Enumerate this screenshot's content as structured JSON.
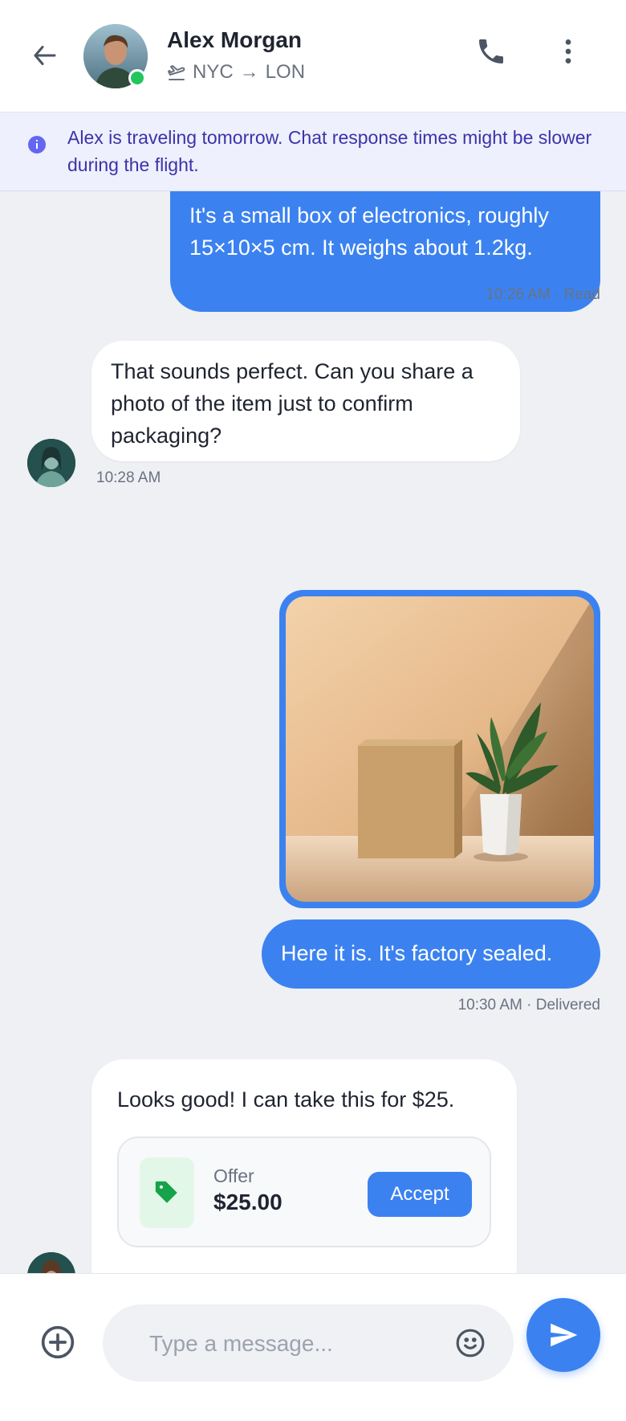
{
  "header": {
    "contact_name": "Alex Morgan",
    "trip_from": "NYC",
    "trip_arrow": "→",
    "trip_to": "LON",
    "online": true
  },
  "notice": {
    "text": "Alex is traveling tomorrow. Chat response times might be slower during the flight."
  },
  "messages": [
    {
      "direction": "outgoing",
      "text": "It's a small box of electronics, roughly 15×10×5 cm. It weighs about 1.2kg.",
      "time": "10:26 AM",
      "status": "Read"
    },
    {
      "direction": "incoming",
      "text": "That sounds perfect. Can you share a photo of the item just to confirm packaging?",
      "time": "10:28 AM"
    },
    {
      "direction": "outgoing",
      "type": "image",
      "image_desc": "cardboard box and potted plant"
    },
    {
      "direction": "outgoing",
      "text": "Here it is. It's factory sealed.",
      "time": "10:30 AM",
      "status": "Delivered"
    },
    {
      "direction": "incoming",
      "text": "Looks good! I can take this for $25.",
      "offer": {
        "label": "Offer",
        "amount": "$25.00",
        "accept_label": "Accept"
      }
    }
  ],
  "meta_separator": " · ",
  "composer": {
    "placeholder": "Type a message..."
  },
  "icons": {
    "back": "arrow-left-icon",
    "call": "phone-icon",
    "more": "more-vertical-icon",
    "plane": "plane-takeoff-icon",
    "info": "info-icon",
    "tag": "tag-icon",
    "attach": "plus-circle-icon",
    "emoji": "smile-icon",
    "send": "send-icon"
  },
  "colors": {
    "accent": "#3b82f0",
    "online": "#22c55e",
    "notice_bg": "#eef0fd",
    "notice_text": "#3b33a8",
    "offer_tag": "#16a34a"
  }
}
